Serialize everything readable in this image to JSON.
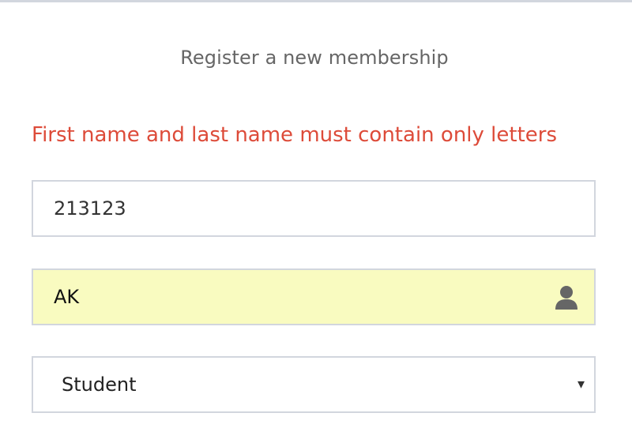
{
  "register": {
    "box_message": "Register a new membership",
    "error_message": "First name and last name must contain only letters",
    "first_name": {
      "value": "213123"
    },
    "last_name": {
      "value": "AK",
      "icon": "user-icon"
    },
    "role": {
      "selected": "Student",
      "caret": "▾"
    }
  },
  "colors": {
    "error": "#dd4b39",
    "autofill_bg": "#f9fbc0",
    "border": "#d2d6de"
  }
}
